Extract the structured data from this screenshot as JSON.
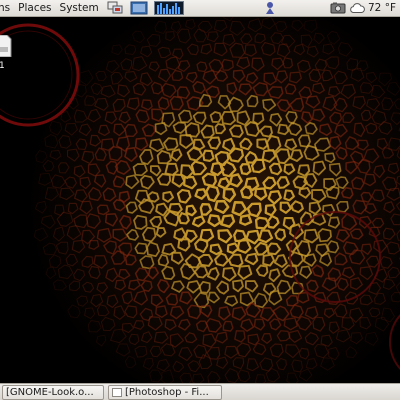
{
  "top_panel": {
    "menus": [
      {
        "id": "applications",
        "label": "ns"
      },
      {
        "id": "places",
        "label": "Places"
      },
      {
        "id": "system",
        "label": "System"
      }
    ],
    "weather": {
      "icon": "cloud-icon",
      "temperature": "72 °F"
    }
  },
  "desktop": {
    "icon_label": "1"
  },
  "taskbar": {
    "items": [
      {
        "label": "[GNOME-Look.o..."
      },
      {
        "label": "[Photoshop - Fi..."
      }
    ]
  },
  "colors": {
    "panel_bg": "#e4e1dc",
    "wallpaper_bg": "#000000",
    "wallpaper_cell_bright": "#c99b2e",
    "wallpaper_cell_mid": "#8a2a10",
    "wallpaper_ring": "#8b0d0d"
  }
}
